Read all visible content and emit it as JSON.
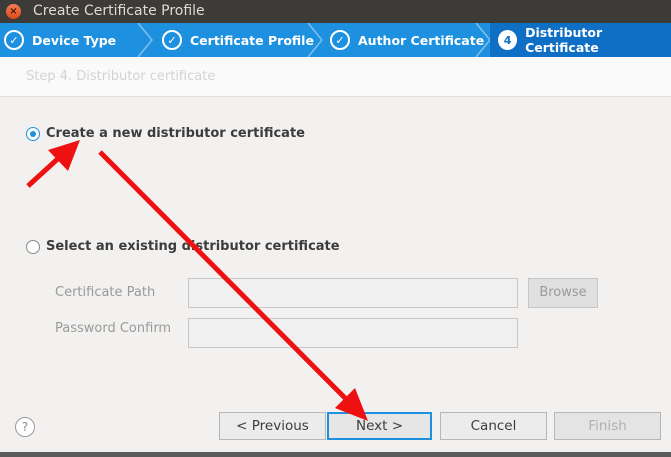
{
  "window": {
    "title": "Create Certificate Profile",
    "close_glyph": "×"
  },
  "wizard": {
    "steps": [
      {
        "label": "Device Type",
        "state": "done"
      },
      {
        "label": "Certificate Profile",
        "state": "done"
      },
      {
        "label": "Author Certificate",
        "state": "done"
      },
      {
        "label": "Distributor Certificate",
        "state": "active",
        "number": "4"
      }
    ]
  },
  "page": {
    "subtitle": "Step 4. Distributor certificate"
  },
  "options": {
    "create_new": {
      "label": "Create a new distributor certificate",
      "checked": true
    },
    "select_existing": {
      "label": "Select an existing distributor certificate",
      "checked": false
    }
  },
  "fields": {
    "certificate_path": {
      "label": "Certificate Path",
      "value": ""
    },
    "password_confirm": {
      "label": "Password Confirm",
      "value": ""
    },
    "browse_label": "Browse"
  },
  "footer": {
    "help_glyph": "?",
    "previous_label": "< Previous",
    "next_label": "Next >",
    "cancel_label": "Cancel",
    "finish_label": "Finish"
  },
  "colors": {
    "accent": "#1e90e0",
    "annotation_arrow": "#ee1111"
  }
}
